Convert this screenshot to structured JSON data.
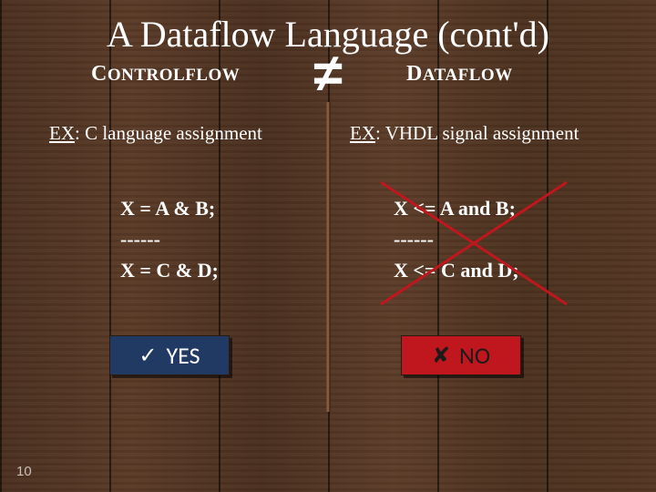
{
  "title": "A Dataflow Language (cont'd)",
  "not_equal_symbol": "≠",
  "left": {
    "heading_big": "C",
    "heading_rest": "ONTROLFLOW",
    "ex_prefix": "EX",
    "ex_rest": ": C language assignment",
    "code_line1": "X = A & B;",
    "code_line2": "------",
    "code_line3": "X = C & D;",
    "badge_mark": "✓",
    "badge_text": "YES"
  },
  "right": {
    "heading_big": "D",
    "heading_rest": "ATAFLOW",
    "ex_prefix": "EX",
    "ex_rest": ": VHDL signal assignment",
    "code_line1": "X <= A and B;",
    "code_line2": "------",
    "code_line3": "X <= C and D;",
    "badge_mark": "✘",
    "badge_text": "NO"
  },
  "page_number": "10"
}
